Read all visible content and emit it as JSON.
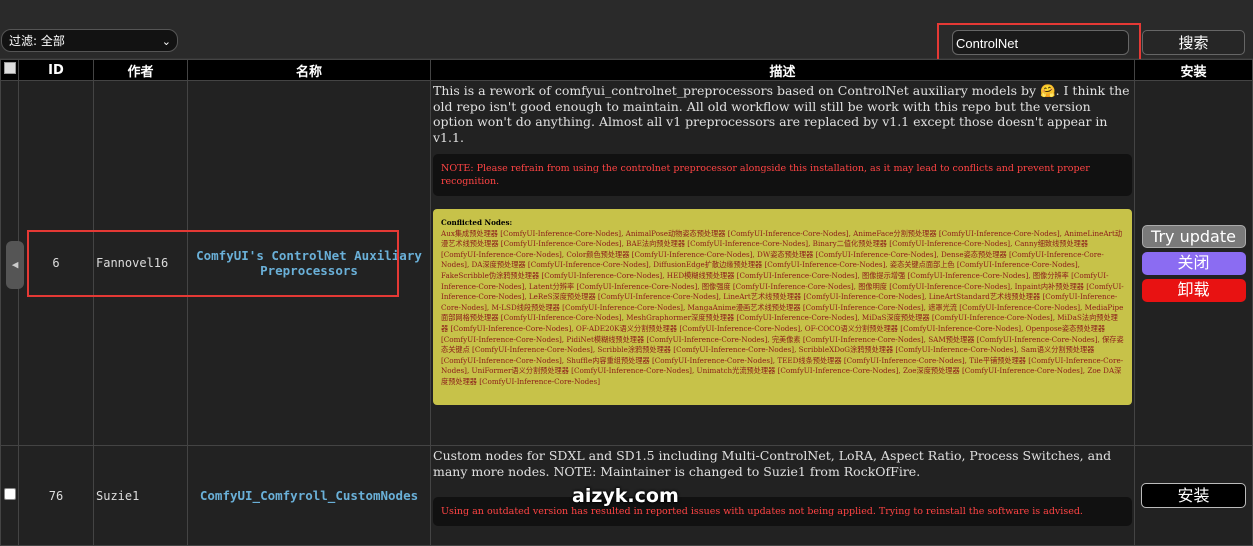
{
  "toolbar": {
    "filter_label": "过滤: 全部",
    "search_value": "ControlNet",
    "search_button": "搜索"
  },
  "table": {
    "headers": {
      "id": "ID",
      "author": "作者",
      "name": "名称",
      "description": "描述",
      "install": "安装"
    },
    "rows": [
      {
        "id": "6",
        "author": "Fannovel16",
        "name": "ComfyUI's ControlNet Auxiliary Preprocessors",
        "description": "This is a rework of comfyui_controlnet_preprocessors based on ControlNet auxiliary models by 🤗. I think the old repo isn't good enough to maintain. All old workflow will still be work with this repo but the version option won't do anything. Almost all v1 preprocessors are replaced by v1.1 except those doesn't appear in v1.1.",
        "note": "NOTE: Please refrain from using the controlnet preprocessor alongside this installation, as it may lead to conflicts and prevent proper recognition.",
        "conflicted_title": "Conflicted Nodes:",
        "conflicted_body": "Aux集成预处理器 [ComfyUI-Inference-Core-Nodes], AnimalPose动物姿态预处理器 [ComfyUI-Inference-Core-Nodes], AnimeFace分割预处理器 [ComfyUI-Inference-Core-Nodes], AnimeLineArt动漫艺术线预处理器 [ComfyUI-Inference-Core-Nodes], BAE法向预处理器 [ComfyUI-Inference-Core-Nodes], Binary二值化预处理器 [ComfyUI-Inference-Core-Nodes], Canny细致线预处理器 [ComfyUI-Inference-Core-Nodes], Color颜色预处理器 [ComfyUI-Inference-Core-Nodes], DW姿态预处理器 [ComfyUI-Inference-Core-Nodes], Dense姿态预处理器 [ComfyUI-Inference-Core-Nodes], DA深度预处理器 [ComfyUI-Inference-Core-Nodes], DiffusionEdge扩散边缘预处理器 [ComfyUI-Inference-Core-Nodes], 姿态关键点面部上色 [ComfyUI-Inference-Core-Nodes], FakeScribble伪涂鸦预处理器 [ComfyUI-Inference-Core-Nodes], HED模糊线预处理器 [ComfyUI-Inference-Core-Nodes], 图像提示增强 [ComfyUI-Inference-Core-Nodes], 图像分辨率 [ComfyUI-Inference-Core-Nodes], Latent分辨率 [ComfyUI-Inference-Core-Nodes], 图像强度 [ComfyUI-Inference-Core-Nodes], 图像明度 [ComfyUI-Inference-Core-Nodes], Inpaint内补预处理器 [ComfyUI-Inference-Core-Nodes], LeReS深度预处理器 [ComfyUI-Inference-Core-Nodes], LineArt艺术线预处理器 [ComfyUI-Inference-Core-Nodes], LineArtStandard艺术线预处理器 [ComfyUI-Inference-Core-Nodes], M-LSD线段预处理器 [ComfyUI-Inference-Core-Nodes], MangaAnime漫画艺术线预处理器 [ComfyUI-Inference-Core-Nodes], 遮罩光流 [ComfyUI-Inference-Core-Nodes], MediaPipe面部网格预处理器 [ComfyUI-Inference-Core-Nodes], MeshGraphormer深度预处理器 [ComfyUI-Inference-Core-Nodes], MiDaS深度预处理器 [ComfyUI-Inference-Core-Nodes], MiDaS法向预处理器 [ComfyUI-Inference-Core-Nodes], OF-ADE20K语义分割预处理器 [ComfyUI-Inference-Core-Nodes], OF-COCO语义分割预处理器 [ComfyUI-Inference-Core-Nodes], Openpose姿态预处理器 [ComfyUI-Inference-Core-Nodes], PidiNet模糊线预处理器 [ComfyUI-Inference-Core-Nodes], 完美像素 [ComfyUI-Inference-Core-Nodes], SAM预处理器 [ComfyUI-Inference-Core-Nodes], 保存姿态关键点 [ComfyUI-Inference-Core-Nodes], Scribble涂鸦预处理器 [ComfyUI-Inference-Core-Nodes], ScribbleXDoG涂鸦预处理器 [ComfyUI-Inference-Core-Nodes], Sam语义分割预处理器 [ComfyUI-Inference-Core-Nodes], Shuffle内容重组预处理器 [ComfyUI-Inference-Core-Nodes], TEED线条预处理器 [ComfyUI-Inference-Core-Nodes], Tile平铺预处理器 [ComfyUI-Inference-Core-Nodes], UniFormer语义分割预处理器 [ComfyUI-Inference-Core-Nodes], Unimatch光流预处理器 [ComfyUI-Inference-Core-Nodes], Zoe深度预处理器 [ComfyUI-Inference-Core-Nodes], Zoe DA深度预处理器 [ComfyUI-Inference-Core-Nodes]",
        "buttons": {
          "try_update": "Try update",
          "close": "关闭",
          "uninstall": "卸载"
        }
      },
      {
        "id": "76",
        "author": "Suzie1",
        "name": "ComfyUI_Comfyroll_CustomNodes",
        "description": "Custom nodes for SDXL and SD1.5 including Multi-ControlNet, LoRA, Aspect Ratio, Process Switches, and many more nodes. NOTE: Maintainer is changed to Suzie1 from RockOfFire.",
        "note": "Using an outdated version has resulted in reported issues with updates not being applied. Trying to reinstall the software is advised.",
        "buttons": {
          "install": "安装"
        }
      }
    ]
  },
  "watermark": "aizyk.com",
  "colors": {
    "highlight_box": "#e53935",
    "conflict_bg": "#c7c249",
    "close_btn": "#8b6cf2",
    "uninstall_btn": "#e81212",
    "link": "#6ab0d8"
  }
}
